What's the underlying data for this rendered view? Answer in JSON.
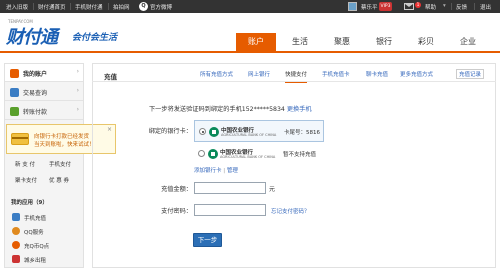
{
  "topbar": {
    "links": [
      "进入旧版",
      "财付通首页",
      "手机财付通",
      "拍拍网",
      "官方微博"
    ],
    "user_name": "蔡乐平",
    "vip_label": "VIP3",
    "mail_count": "1",
    "help": "帮助",
    "feedback": "反馈",
    "logout": "退出"
  },
  "header": {
    "logo_text": "财付通",
    "logo_small": "TENPAY.COM",
    "logo_tagline": "会付会生活",
    "nav": [
      "账户",
      "生活",
      "聚惠",
      "银行",
      "彩贝",
      "企业"
    ],
    "nav_active": 0
  },
  "sidebar": {
    "items": [
      {
        "label": "我的账户",
        "arrow": "›",
        "color": "#e65c00"
      },
      {
        "label": "交易查询",
        "arrow": "›",
        "color": "#3b7dc4"
      },
      {
        "label": "转账付款",
        "arrow": "›",
        "color": "#5aa02c"
      }
    ],
    "grid": [
      "新 支 付",
      "手机支付",
      "聚卡支付",
      "优 惠 券"
    ],
    "apps_title": "我的应用（9）",
    "apps": [
      {
        "label": "手机充值",
        "color": "#3b7dc4"
      },
      {
        "label": "QQ服务",
        "color": "#e08a1e"
      },
      {
        "label": "充Q币Q点",
        "color": "#e65c00"
      },
      {
        "label": "城乡出租",
        "color": "#c33"
      }
    ]
  },
  "tooltip": {
    "line1": "向银行卡打款已经发货",
    "line2": "当天到账啦，快来试试！",
    "close": "×"
  },
  "main": {
    "title": "充值",
    "tabs": [
      "所有充值方式",
      "网上银行",
      "快捷支付",
      "手机充值卡",
      "聊卡充值",
      "更多充值方式",
      "充值记录"
    ],
    "tab_active": 2,
    "phone_info": "下一步将发送验证码到绑定的手机152*****5834",
    "change_phone": "更换手机",
    "bank_label": "绑定的银行卡：",
    "banks": [
      {
        "name": "中国农业银行",
        "sub": "AGRICULTURAL BANK OF CHINA",
        "meta": "卡尾号：5816",
        "selected": true
      },
      {
        "name": "中国农业银行",
        "sub": "AGRICULTURAL BANK OF CHINA",
        "meta": "暂不支持充值",
        "selected": false
      }
    ],
    "add_card": "添加银行卡",
    "manage": "管理",
    "amount_label": "充值金额：",
    "amount_value": "",
    "amount_unit": "元",
    "password_label": "支付密码：",
    "password_value": "",
    "forgot": "忘记支付密码？",
    "next_button": "下一步"
  }
}
